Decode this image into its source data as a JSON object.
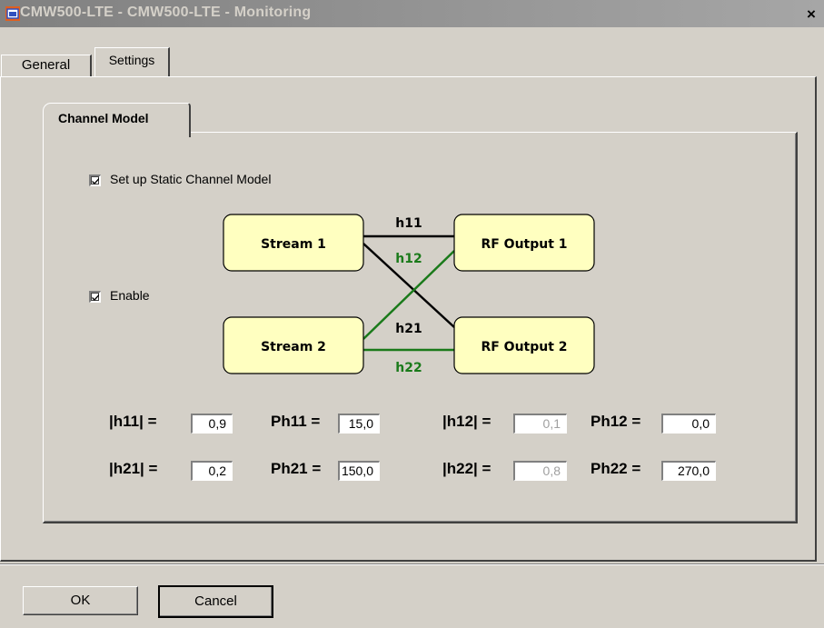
{
  "window": {
    "title": "CMW500-LTE - CMW500-LTE - Monitoring",
    "close_label": "×"
  },
  "tabs": [
    {
      "label": "General",
      "active": false
    },
    {
      "label": "Settings",
      "active": true
    }
  ],
  "channel_model": {
    "tab_label": "Channel Model",
    "static_checkbox": {
      "label": "Set up Static Channel Model",
      "checked": true
    },
    "enable_checkbox": {
      "label": "Enable",
      "checked": true
    },
    "diagram": {
      "stream1": "Stream 1",
      "stream2": "Stream 2",
      "rf1": "RF Output 1",
      "rf2": "RF Output 2",
      "h11": "h11",
      "h12": "h12",
      "h21": "h21",
      "h22": "h22",
      "colors": {
        "black_path": "#000000",
        "green_path": "#1a7a1a",
        "node_fill": "#ffffc0"
      }
    },
    "params": {
      "h11_label": "|h11| =",
      "h11_value": "0,9",
      "ph11_label": "Ph11 =",
      "ph11_value": "15,0",
      "h12_label": "|h12| =",
      "h12_value": "0,1",
      "ph12_label": "Ph12 =",
      "ph12_value": "0,0",
      "h21_label": "|h21| =",
      "h21_value": "0,2",
      "ph21_label": "Ph21 =",
      "ph21_value": "150,0",
      "h22_label": "|h22| =",
      "h22_value": "0,8",
      "ph22_label": "Ph22 =",
      "ph22_value": "270,0"
    }
  },
  "buttons": {
    "ok": "OK",
    "cancel": "Cancel"
  }
}
